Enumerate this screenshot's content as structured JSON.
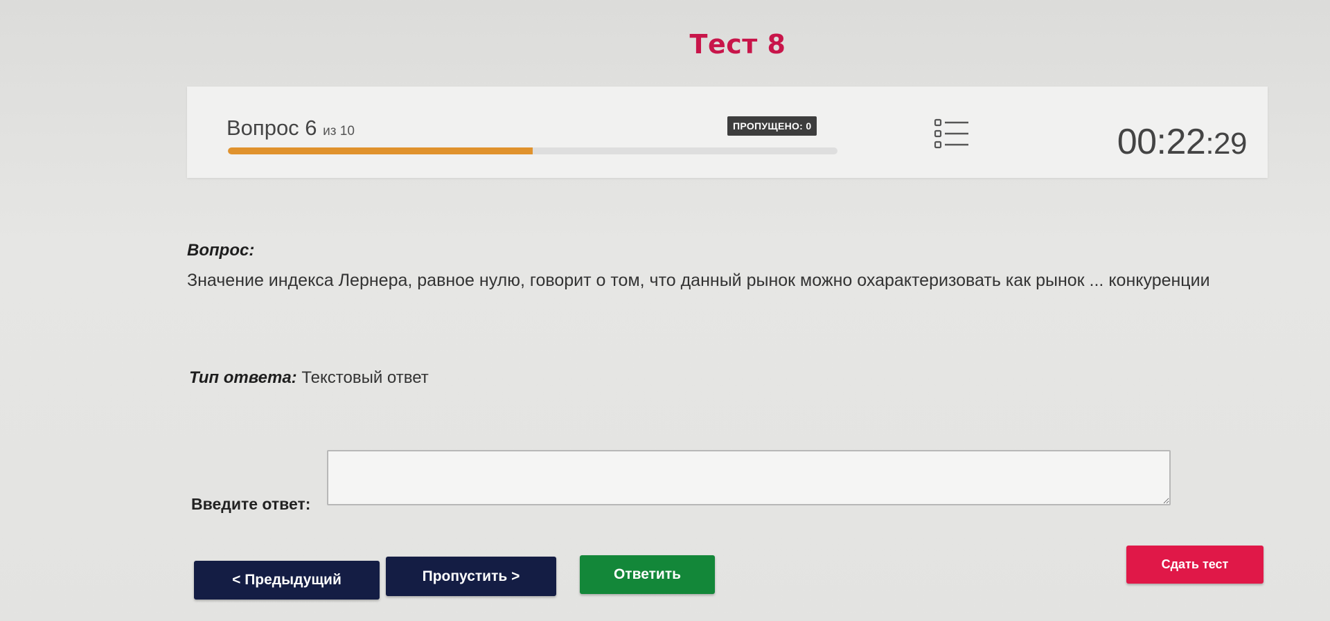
{
  "page": {
    "title": "Тест 8"
  },
  "status": {
    "question_label": "Вопрос 6",
    "of_label": "из 10",
    "progress": 0.5,
    "skipped_label": "ПРОПУЩЕНО: 0",
    "timer_main": "00:22",
    "timer_seconds": ":29",
    "list_icon": "question-list-icon"
  },
  "question": {
    "label": "Вопрос:",
    "text": "Значение индекса Лернера, равное нулю, говорит о том, что данный рынок можно охарактеризовать как рынок ... конкуренции"
  },
  "answer_type": {
    "label": "Тип ответа:",
    "value": "Текстовый ответ"
  },
  "answer": {
    "label": "Введите ответ:",
    "value": ""
  },
  "buttons": {
    "prev": "< Предыдущий",
    "skip": "Пропустить >",
    "answer": "Ответить",
    "submit": "Сдать тест"
  },
  "colors": {
    "title": "#c8154a",
    "progress": "#e0922d",
    "nav_button": "#141d44",
    "answer_button": "#138739",
    "submit_button": "#e01848"
  }
}
